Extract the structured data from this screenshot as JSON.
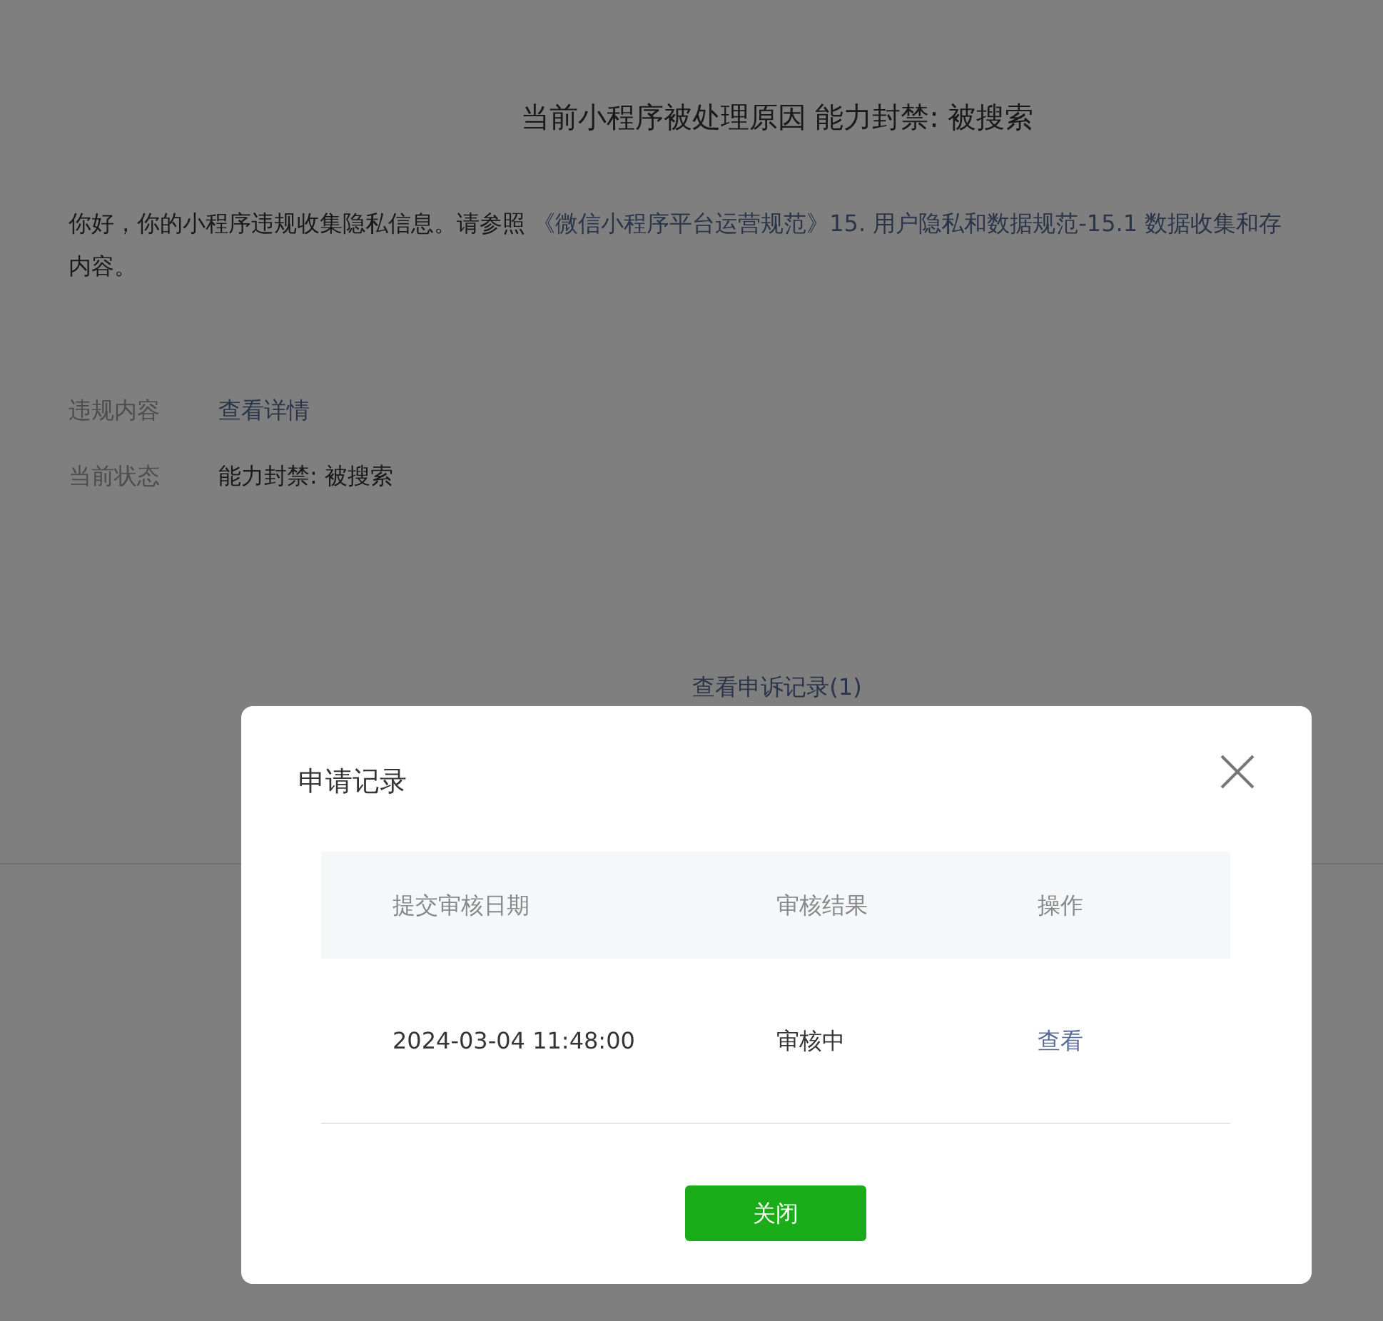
{
  "page": {
    "title": "当前小程序被处理原因 能力封禁: 被搜索",
    "notice": {
      "text": "你好，你的小程序违规收集隐私信息。请参照",
      "link": "《微信小程序平台运营规范》15. 用户隐私和数据规范-15.1 数据收集和存",
      "tail": "内容。"
    },
    "fields": [
      {
        "label": "违规内容",
        "value": "查看详情",
        "kind": "link"
      },
      {
        "label": "当前状态",
        "value": "能力封禁: 被搜索",
        "kind": "text"
      }
    ],
    "appeal_link": "查看申诉记录(1)"
  },
  "dialog": {
    "title": "申请记录",
    "table": {
      "columns": [
        "提交审核日期",
        "审核结果",
        "操作"
      ],
      "rows": [
        {
          "date": "2024-03-04 11:48:00",
          "result": "审核中",
          "action": "查看"
        }
      ]
    },
    "button": "关闭"
  }
}
